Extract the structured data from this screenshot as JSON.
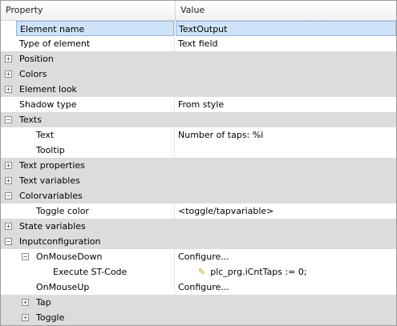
{
  "header": {
    "property": "Property",
    "value": "Value"
  },
  "rows": [
    {
      "name": "Element name",
      "value": "TextOutput"
    },
    {
      "name": "Type of element",
      "value": "Text field"
    },
    {
      "name": "Position",
      "value": "",
      "toggle": "+"
    },
    {
      "name": "Colors",
      "value": "",
      "toggle": "+"
    },
    {
      "name": "Element look",
      "value": "",
      "toggle": "+"
    },
    {
      "name": "Shadow type",
      "value": "From style"
    },
    {
      "name": "Texts",
      "value": "",
      "toggle": "−"
    },
    {
      "name": "Text",
      "value": "Number of taps: %i"
    },
    {
      "name": "Tooltip",
      "value": ""
    },
    {
      "name": "Text properties",
      "value": "",
      "toggle": "+"
    },
    {
      "name": "Text variables",
      "value": "",
      "toggle": "+"
    },
    {
      "name": "Colorvariables",
      "value": "",
      "toggle": "−"
    },
    {
      "name": "Toggle color",
      "value": "<toggle/tapvariable>"
    },
    {
      "name": "State variables",
      "value": "",
      "toggle": "+"
    },
    {
      "name": "Inputconfiguration",
      "value": "",
      "toggle": "−"
    },
    {
      "name": "OnMouseDown",
      "value": "Configure...",
      "toggle": "−"
    },
    {
      "name": "Execute ST-Code",
      "value": "plc_prg.iCntTaps := 0;",
      "icon": "pencil-icon"
    },
    {
      "name": "OnMouseUp",
      "value": "Configure..."
    },
    {
      "name": "Tap",
      "value": "",
      "toggle": "+"
    },
    {
      "name": "Toggle",
      "value": "",
      "toggle": "+"
    }
  ]
}
